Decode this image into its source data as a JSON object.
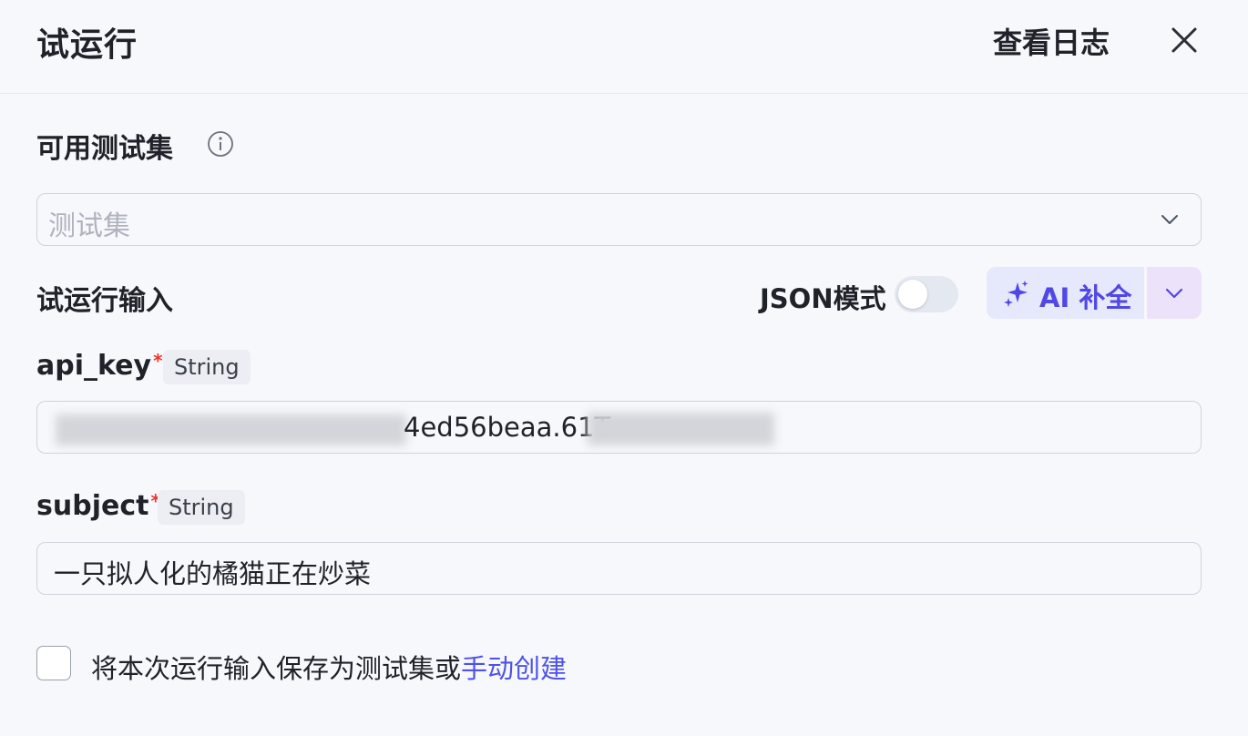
{
  "header": {
    "title": "试运行",
    "view_logs_label": "查看日志"
  },
  "test_sets": {
    "label": "可用测试集",
    "placeholder": "测试集"
  },
  "run_input": {
    "label": "试运行输入",
    "json_mode_label": "JSON模式",
    "json_mode_enabled": false,
    "ai_complete_label": "AI 补全"
  },
  "fields": [
    {
      "name": "api_key",
      "type": "String",
      "required_mark": "*",
      "visible_value": "4ed56beaa.61T"
    },
    {
      "name": "subject",
      "type": "String",
      "required_mark": "*",
      "value": "一只拟人化的橘猫正在炒菜"
    }
  ],
  "save_option": {
    "checked": false,
    "text": "将本次运行输入保存为测试集或",
    "link_text": "手动创建"
  },
  "colors": {
    "accent": "#4d53e8",
    "required": "#e8362c",
    "background": "#f7f8fc"
  },
  "icons": {
    "close": "close-icon",
    "info": "info-icon",
    "select_chevron": "chevron-down-icon",
    "ai_sparkle": "sparkle-icon",
    "ai_dropdown": "chevron-down-icon"
  }
}
